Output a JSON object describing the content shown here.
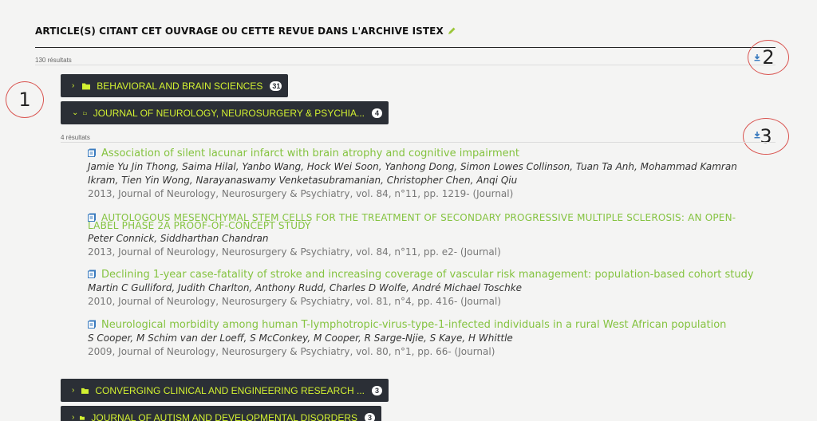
{
  "section": {
    "title": "ARTICLE(S) CITANT CET OUVRAGE OU CETTE REVUE DANS L'ARCHIVE ISTEX",
    "result_count": "130 résultats"
  },
  "annotations": [
    "1",
    "2",
    "3"
  ],
  "folders": [
    {
      "label": "BEHAVIORAL AND BRAIN SCIENCES",
      "count": "31",
      "expanded": false
    },
    {
      "label": "JOURNAL OF NEUROLOGY, NEUROSURGERY & PSYCHIA...",
      "count": "4",
      "expanded": true
    },
    {
      "label": "CONVERGING CLINICAL AND ENGINEERING RESEARCH ...",
      "count": "3",
      "expanded": false
    },
    {
      "label": "JOURNAL OF AUTISM AND DEVELOPMENTAL DISORDERS",
      "count": "3",
      "expanded": false
    }
  ],
  "expanded_folder": {
    "result_count": "4 résultats",
    "articles": [
      {
        "title": "Association of silent lacunar infarct with brain atrophy and cognitive impairment",
        "authors": "Jamie Yu Jin Thong, Saima Hilal, Yanbo Wang, Hock Wei Soon, Yanhong Dong, Simon Lowes Collinson, Tuan Ta Anh, Mohammad Kamran Ikram, Tien Yin Wong, Narayanaswamy Venketasubramanian, Christopher Chen, Anqi Qiu",
        "meta": "2013, Journal of Neurology, Neurosurgery & Psychiatry, vol. 84, n°11, pp. 1219- (Journal)"
      },
      {
        "title": "AUTOLOGOUS MESENCHYMAL STEM CELLS FOR THE TREATMENT OF SECONDARY PROGRESSIVE MULTIPLE SCLEROSIS: AN OPEN-LABEL PHASE 2A PROOF-OF-CONCEPT STUDY",
        "authors": "Peter Connick, Siddharthan Chandran",
        "meta": "2013, Journal of Neurology, Neurosurgery & Psychiatry, vol. 84, n°11, pp. e2- (Journal)"
      },
      {
        "title": "Declining 1-year case-fatality of stroke and increasing coverage of vascular risk management: population-based cohort study",
        "authors": "Martin C Gulliford, Judith Charlton, Anthony Rudd, Charles D Wolfe, André Michael Toschke",
        "meta": "2010, Journal of Neurology, Neurosurgery & Psychiatry, vol. 81, n°4, pp. 416- (Journal)"
      },
      {
        "title": "Neurological morbidity among human T-lymphotropic-virus-type-1-infected individuals in a rural West African population",
        "authors": "S Cooper, M Schim van der Loeff, S McConkey, M Cooper, R Sarge-Njie, S Kaye, H Whittle",
        "meta": "2009, Journal of Neurology, Neurosurgery & Psychiatry, vol. 80, n°1, pp. 66- (Journal)"
      }
    ]
  },
  "colors": {
    "accent": "#d2f031",
    "link": "#85c341",
    "button_bg": "#2b2f36",
    "annotation": "#d9534f"
  }
}
